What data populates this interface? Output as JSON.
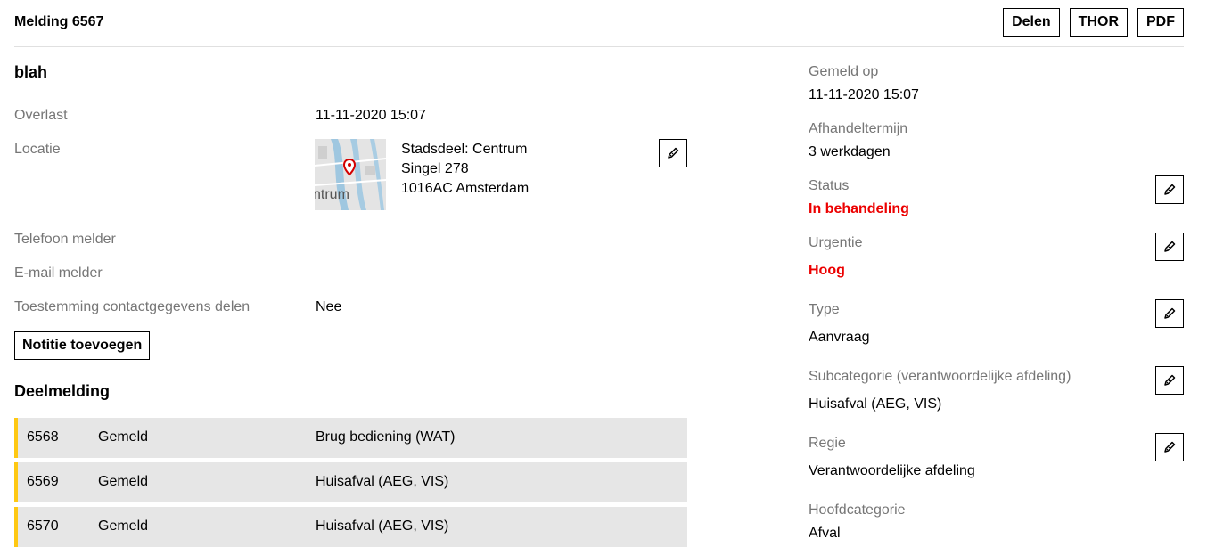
{
  "header": {
    "title": "Melding 6567",
    "share_label": "Delen",
    "thor_label": "THOR",
    "pdf_label": "PDF"
  },
  "main": {
    "title": "blah",
    "fields": {
      "overlast_label": "Overlast",
      "overlast_value": "11-11-2020 15:07",
      "locatie_label": "Locatie",
      "address_line1": "Stadsdeel: Centrum",
      "address_line2": "Singel 278",
      "address_line3": "1016AC Amsterdam",
      "map_label": "ntrum",
      "phone_label": "Telefoon melder",
      "email_label": "E-mail melder",
      "consent_label": "Toestemming contactgegevens delen",
      "consent_value": "Nee"
    },
    "note_button_label": "Notitie toevoegen",
    "sub_title": "Deelmelding",
    "sub_reports": [
      {
        "id": "6568",
        "status": "Gemeld",
        "category": "Brug bediening (WAT)"
      },
      {
        "id": "6569",
        "status": "Gemeld",
        "category": "Huisafval (AEG, VIS)"
      },
      {
        "id": "6570",
        "status": "Gemeld",
        "category": "Huisafval (AEG, VIS)"
      }
    ],
    "sub_report_accent_color": "#fec813"
  },
  "sidebar": {
    "gemeld_op_label": "Gemeld op",
    "gemeld_op_value": "11-11-2020 15:07",
    "afhandel_label": "Afhandeltermijn",
    "afhandel_value": "3 werkdagen",
    "status_label": "Status",
    "status_value": "In behandeling",
    "urgentie_label": "Urgentie",
    "urgentie_value": "Hoog",
    "type_label": "Type",
    "type_value": "Aanvraag",
    "subcat_label": "Subcategorie (verantwoordelijke afdeling)",
    "subcat_value": "Huisafval (AEG, VIS)",
    "regie_label": "Regie",
    "regie_value": "Verantwoordelijke afdeling",
    "hoofdcat_label": "Hoofdcategorie",
    "hoofdcat_value": "Afval",
    "alert_color": "#ec0000"
  }
}
